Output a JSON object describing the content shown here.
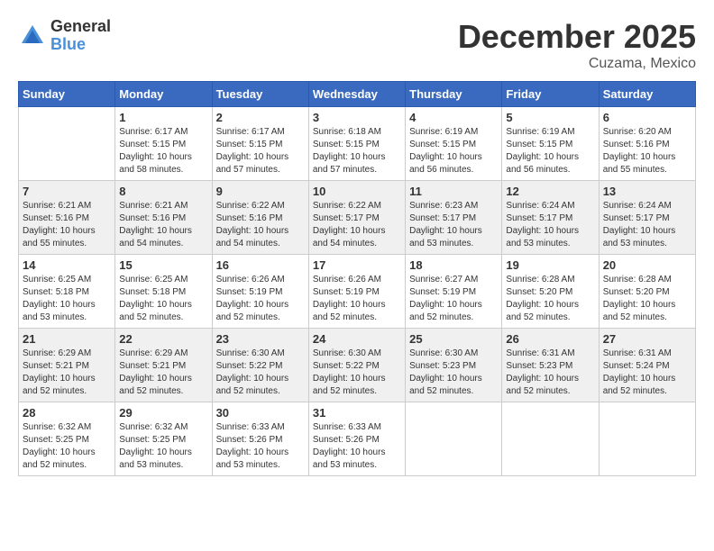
{
  "logo": {
    "general": "General",
    "blue": "Blue"
  },
  "title": "December 2025",
  "location": "Cuzama, Mexico",
  "days_header": [
    "Sunday",
    "Monday",
    "Tuesday",
    "Wednesday",
    "Thursday",
    "Friday",
    "Saturday"
  ],
  "weeks": [
    [
      {
        "day": "",
        "sunrise": "",
        "sunset": "",
        "daylight": ""
      },
      {
        "day": "1",
        "sunrise": "Sunrise: 6:17 AM",
        "sunset": "Sunset: 5:15 PM",
        "daylight": "Daylight: 10 hours and 58 minutes."
      },
      {
        "day": "2",
        "sunrise": "Sunrise: 6:17 AM",
        "sunset": "Sunset: 5:15 PM",
        "daylight": "Daylight: 10 hours and 57 minutes."
      },
      {
        "day": "3",
        "sunrise": "Sunrise: 6:18 AM",
        "sunset": "Sunset: 5:15 PM",
        "daylight": "Daylight: 10 hours and 57 minutes."
      },
      {
        "day": "4",
        "sunrise": "Sunrise: 6:19 AM",
        "sunset": "Sunset: 5:15 PM",
        "daylight": "Daylight: 10 hours and 56 minutes."
      },
      {
        "day": "5",
        "sunrise": "Sunrise: 6:19 AM",
        "sunset": "Sunset: 5:15 PM",
        "daylight": "Daylight: 10 hours and 56 minutes."
      },
      {
        "day": "6",
        "sunrise": "Sunrise: 6:20 AM",
        "sunset": "Sunset: 5:16 PM",
        "daylight": "Daylight: 10 hours and 55 minutes."
      }
    ],
    [
      {
        "day": "7",
        "sunrise": "Sunrise: 6:21 AM",
        "sunset": "Sunset: 5:16 PM",
        "daylight": "Daylight: 10 hours and 55 minutes."
      },
      {
        "day": "8",
        "sunrise": "Sunrise: 6:21 AM",
        "sunset": "Sunset: 5:16 PM",
        "daylight": "Daylight: 10 hours and 54 minutes."
      },
      {
        "day": "9",
        "sunrise": "Sunrise: 6:22 AM",
        "sunset": "Sunset: 5:16 PM",
        "daylight": "Daylight: 10 hours and 54 minutes."
      },
      {
        "day": "10",
        "sunrise": "Sunrise: 6:22 AM",
        "sunset": "Sunset: 5:17 PM",
        "daylight": "Daylight: 10 hours and 54 minutes."
      },
      {
        "day": "11",
        "sunrise": "Sunrise: 6:23 AM",
        "sunset": "Sunset: 5:17 PM",
        "daylight": "Daylight: 10 hours and 53 minutes."
      },
      {
        "day": "12",
        "sunrise": "Sunrise: 6:24 AM",
        "sunset": "Sunset: 5:17 PM",
        "daylight": "Daylight: 10 hours and 53 minutes."
      },
      {
        "day": "13",
        "sunrise": "Sunrise: 6:24 AM",
        "sunset": "Sunset: 5:17 PM",
        "daylight": "Daylight: 10 hours and 53 minutes."
      }
    ],
    [
      {
        "day": "14",
        "sunrise": "Sunrise: 6:25 AM",
        "sunset": "Sunset: 5:18 PM",
        "daylight": "Daylight: 10 hours and 53 minutes."
      },
      {
        "day": "15",
        "sunrise": "Sunrise: 6:25 AM",
        "sunset": "Sunset: 5:18 PM",
        "daylight": "Daylight: 10 hours and 52 minutes."
      },
      {
        "day": "16",
        "sunrise": "Sunrise: 6:26 AM",
        "sunset": "Sunset: 5:19 PM",
        "daylight": "Daylight: 10 hours and 52 minutes."
      },
      {
        "day": "17",
        "sunrise": "Sunrise: 6:26 AM",
        "sunset": "Sunset: 5:19 PM",
        "daylight": "Daylight: 10 hours and 52 minutes."
      },
      {
        "day": "18",
        "sunrise": "Sunrise: 6:27 AM",
        "sunset": "Sunset: 5:19 PM",
        "daylight": "Daylight: 10 hours and 52 minutes."
      },
      {
        "day": "19",
        "sunrise": "Sunrise: 6:28 AM",
        "sunset": "Sunset: 5:20 PM",
        "daylight": "Daylight: 10 hours and 52 minutes."
      },
      {
        "day": "20",
        "sunrise": "Sunrise: 6:28 AM",
        "sunset": "Sunset: 5:20 PM",
        "daylight": "Daylight: 10 hours and 52 minutes."
      }
    ],
    [
      {
        "day": "21",
        "sunrise": "Sunrise: 6:29 AM",
        "sunset": "Sunset: 5:21 PM",
        "daylight": "Daylight: 10 hours and 52 minutes."
      },
      {
        "day": "22",
        "sunrise": "Sunrise: 6:29 AM",
        "sunset": "Sunset: 5:21 PM",
        "daylight": "Daylight: 10 hours and 52 minutes."
      },
      {
        "day": "23",
        "sunrise": "Sunrise: 6:30 AM",
        "sunset": "Sunset: 5:22 PM",
        "daylight": "Daylight: 10 hours and 52 minutes."
      },
      {
        "day": "24",
        "sunrise": "Sunrise: 6:30 AM",
        "sunset": "Sunset: 5:22 PM",
        "daylight": "Daylight: 10 hours and 52 minutes."
      },
      {
        "day": "25",
        "sunrise": "Sunrise: 6:30 AM",
        "sunset": "Sunset: 5:23 PM",
        "daylight": "Daylight: 10 hours and 52 minutes."
      },
      {
        "day": "26",
        "sunrise": "Sunrise: 6:31 AM",
        "sunset": "Sunset: 5:23 PM",
        "daylight": "Daylight: 10 hours and 52 minutes."
      },
      {
        "day": "27",
        "sunrise": "Sunrise: 6:31 AM",
        "sunset": "Sunset: 5:24 PM",
        "daylight": "Daylight: 10 hours and 52 minutes."
      }
    ],
    [
      {
        "day": "28",
        "sunrise": "Sunrise: 6:32 AM",
        "sunset": "Sunset: 5:25 PM",
        "daylight": "Daylight: 10 hours and 52 minutes."
      },
      {
        "day": "29",
        "sunrise": "Sunrise: 6:32 AM",
        "sunset": "Sunset: 5:25 PM",
        "daylight": "Daylight: 10 hours and 53 minutes."
      },
      {
        "day": "30",
        "sunrise": "Sunrise: 6:33 AM",
        "sunset": "Sunset: 5:26 PM",
        "daylight": "Daylight: 10 hours and 53 minutes."
      },
      {
        "day": "31",
        "sunrise": "Sunrise: 6:33 AM",
        "sunset": "Sunset: 5:26 PM",
        "daylight": "Daylight: 10 hours and 53 minutes."
      },
      {
        "day": "",
        "sunrise": "",
        "sunset": "",
        "daylight": ""
      },
      {
        "day": "",
        "sunrise": "",
        "sunset": "",
        "daylight": ""
      },
      {
        "day": "",
        "sunrise": "",
        "sunset": "",
        "daylight": ""
      }
    ]
  ]
}
